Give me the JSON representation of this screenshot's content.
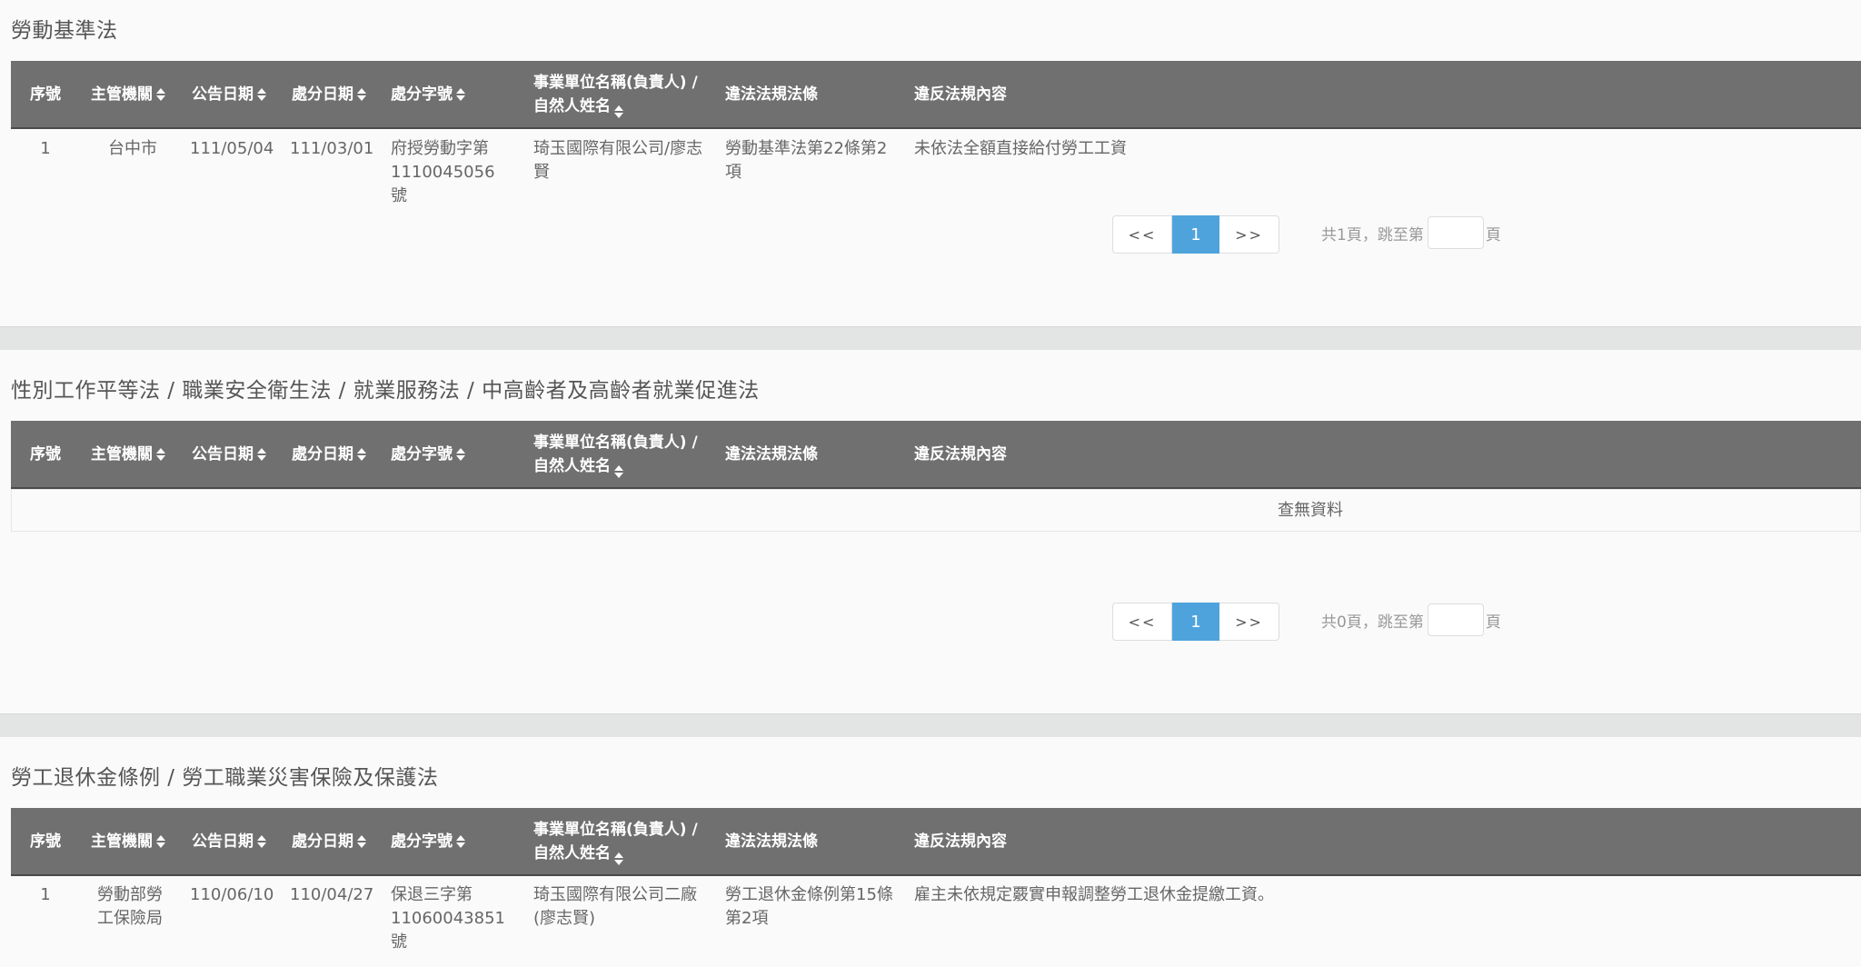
{
  "headers": {
    "seq": "序號",
    "agency": "主管機關",
    "announce_date": "公告日期",
    "penalty_date": "處分日期",
    "penalty_no": "處分字號",
    "entity_line1": "事業單位名稱(負責人) /",
    "entity_line2": "自然人姓名",
    "law": "違法法規法條",
    "content": "違反法規內容"
  },
  "sections": [
    {
      "title": "勞動基準法",
      "rows": [
        {
          "seq": "1",
          "agency": "台中市",
          "announce_date": "111/05/04",
          "penalty_date": "111/03/01",
          "penalty_no": "府授勞動字第1110045056號",
          "entity": "琦玉國際有限公司/廖志賢",
          "law": "勞動基準法第22條第2項",
          "content": "未依法全額直接給付勞工工資"
        }
      ],
      "pager": {
        "prev": "<<",
        "current": "1",
        "next": ">>",
        "summary": "共1頁，跳至第",
        "suffix": "頁"
      }
    },
    {
      "title": "性別工作平等法 / 職業安全衛生法 / 就業服務法 / 中高齡者及高齡者就業促進法",
      "empty_text": "查無資料",
      "pager": {
        "prev": "<<",
        "current": "1",
        "next": ">>",
        "summary": "共0頁，跳至第",
        "suffix": "頁"
      }
    },
    {
      "title": "勞工退休金條例 / 勞工職業災害保險及保護法",
      "rows": [
        {
          "seq": "1",
          "agency": "勞動部勞工保險局",
          "announce_date": "110/06/10",
          "penalty_date": "110/04/27",
          "penalty_no": "保退三字第11060043851號",
          "entity": "琦玉國際有限公司二廠(廖志賢)",
          "law": "勞工退休金條例第15條第2項",
          "content": "雇主未依規定覈實申報調整勞工退休金提繳工資。"
        }
      ]
    }
  ]
}
